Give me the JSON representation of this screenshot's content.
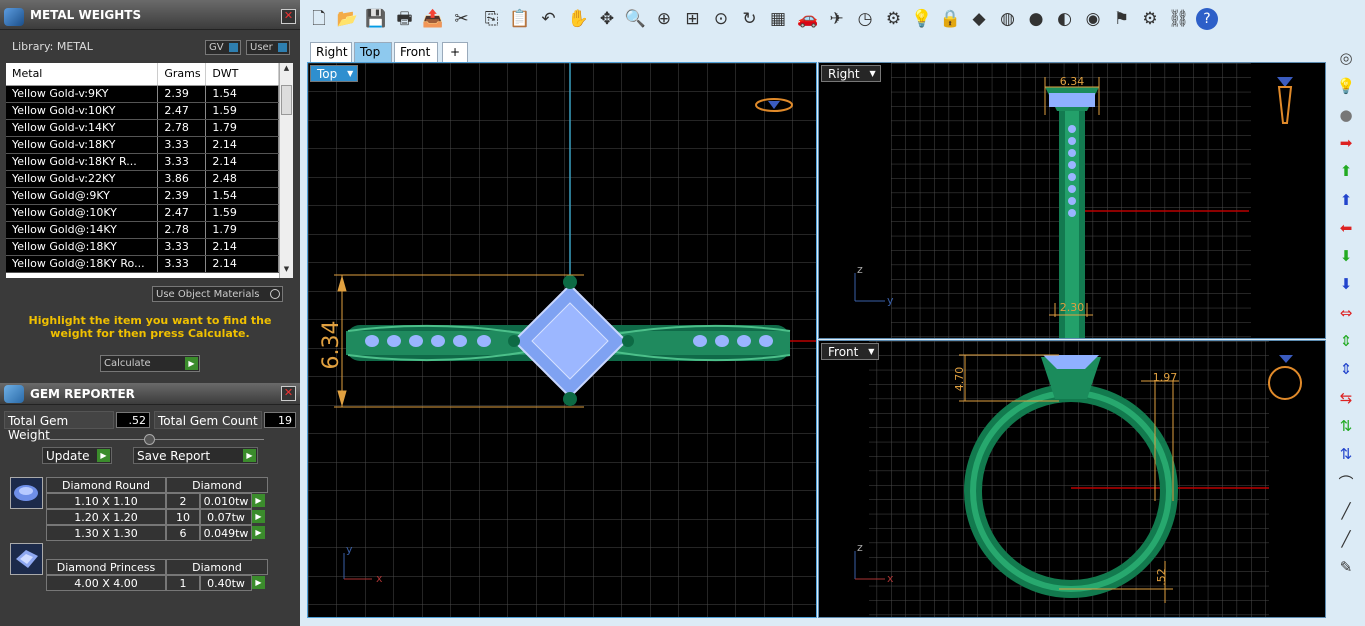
{
  "metal_panel": {
    "title": "METAL WEIGHTS",
    "library_label": "Library: METAL",
    "toggle_gv": "GV",
    "toggle_user": "User",
    "columns": [
      "Metal",
      "Grams",
      "DWT"
    ],
    "rows": [
      [
        "Yellow Gold-v:9KY",
        "2.39",
        "1.54"
      ],
      [
        "Yellow Gold-v:10KY",
        "2.47",
        "1.59"
      ],
      [
        "Yellow Gold-v:14KY",
        "2.78",
        "1.79"
      ],
      [
        "Yellow Gold-v:18KY",
        "3.33",
        "2.14"
      ],
      [
        "Yellow Gold-v:18KY R...",
        "3.33",
        "2.14"
      ],
      [
        "Yellow Gold-v:22KY",
        "3.86",
        "2.48"
      ],
      [
        "Yellow Gold@:9KY",
        "2.39",
        "1.54"
      ],
      [
        "Yellow Gold@:10KY",
        "2.47",
        "1.59"
      ],
      [
        "Yellow Gold@:14KY",
        "2.78",
        "1.79"
      ],
      [
        "Yellow Gold@:18KY",
        "3.33",
        "2.14"
      ],
      [
        "Yellow Gold@:18KY Ro...",
        "3.33",
        "2.14"
      ]
    ],
    "use_object_materials": "Use Object Materials",
    "hint": "Highlight the item you want to find the weight for then press Calculate.",
    "calculate": "Calculate"
  },
  "gem_panel": {
    "title": "GEM REPORTER",
    "total_weight_label": "Total Gem Weight",
    "total_weight_value": ".52",
    "total_count_label": "Total Gem Count",
    "total_count_value": "19",
    "update": "Update",
    "save_report": "Save Report",
    "groups": [
      {
        "shape": "Diamond Round",
        "material": "Diamond",
        "rows": [
          [
            "1.10 X 1.10",
            "2",
            "0.010tw"
          ],
          [
            "1.20 X 1.20",
            "10",
            "0.07tw"
          ],
          [
            "1.30 X 1.30",
            "6",
            "0.049tw"
          ]
        ]
      },
      {
        "shape": "Diamond Princess",
        "material": "Diamond",
        "rows": [
          [
            "4.00 X 4.00",
            "1",
            "0.40tw"
          ]
        ]
      }
    ]
  },
  "tabs": [
    "Right",
    "Top",
    "Front",
    "+"
  ],
  "active_tab": "Top",
  "viewports": {
    "top": {
      "label": "Top",
      "dim": "6.34"
    },
    "right": {
      "label": "Right",
      "dim_top": "6.34",
      "dim_bottom": "2.30"
    },
    "front": {
      "label": "Front",
      "dim_left": "4.70",
      "dim_right": "1.97",
      "dim_bottom": ".52"
    }
  },
  "axes": {
    "x": "x",
    "y": "y",
    "z": "z"
  },
  "toolbar_icons": [
    "new-icon",
    "open-icon",
    "save-icon",
    "print-icon",
    "export-icon",
    "cut-icon",
    "copy-icon",
    "paste-icon",
    "undo-icon",
    "pan-hand-icon",
    "rotate-view-icon",
    "zoom-icon",
    "zoom-window-icon",
    "zoom-extents-icon",
    "zoom-selected-icon",
    "zoom-dynamic-icon",
    "four-viewports-icon",
    "car-icon",
    "plane-icon",
    "clock-icon",
    "snap-icon",
    "lightbulb-icon",
    "lock-icon",
    "render-icon",
    "color-wheel-icon",
    "sphere-shaded-icon",
    "sphere-metal-icon",
    "sphere-blue-icon",
    "flag-icon",
    "gear-icon",
    "network-icon",
    "help-icon"
  ]
}
